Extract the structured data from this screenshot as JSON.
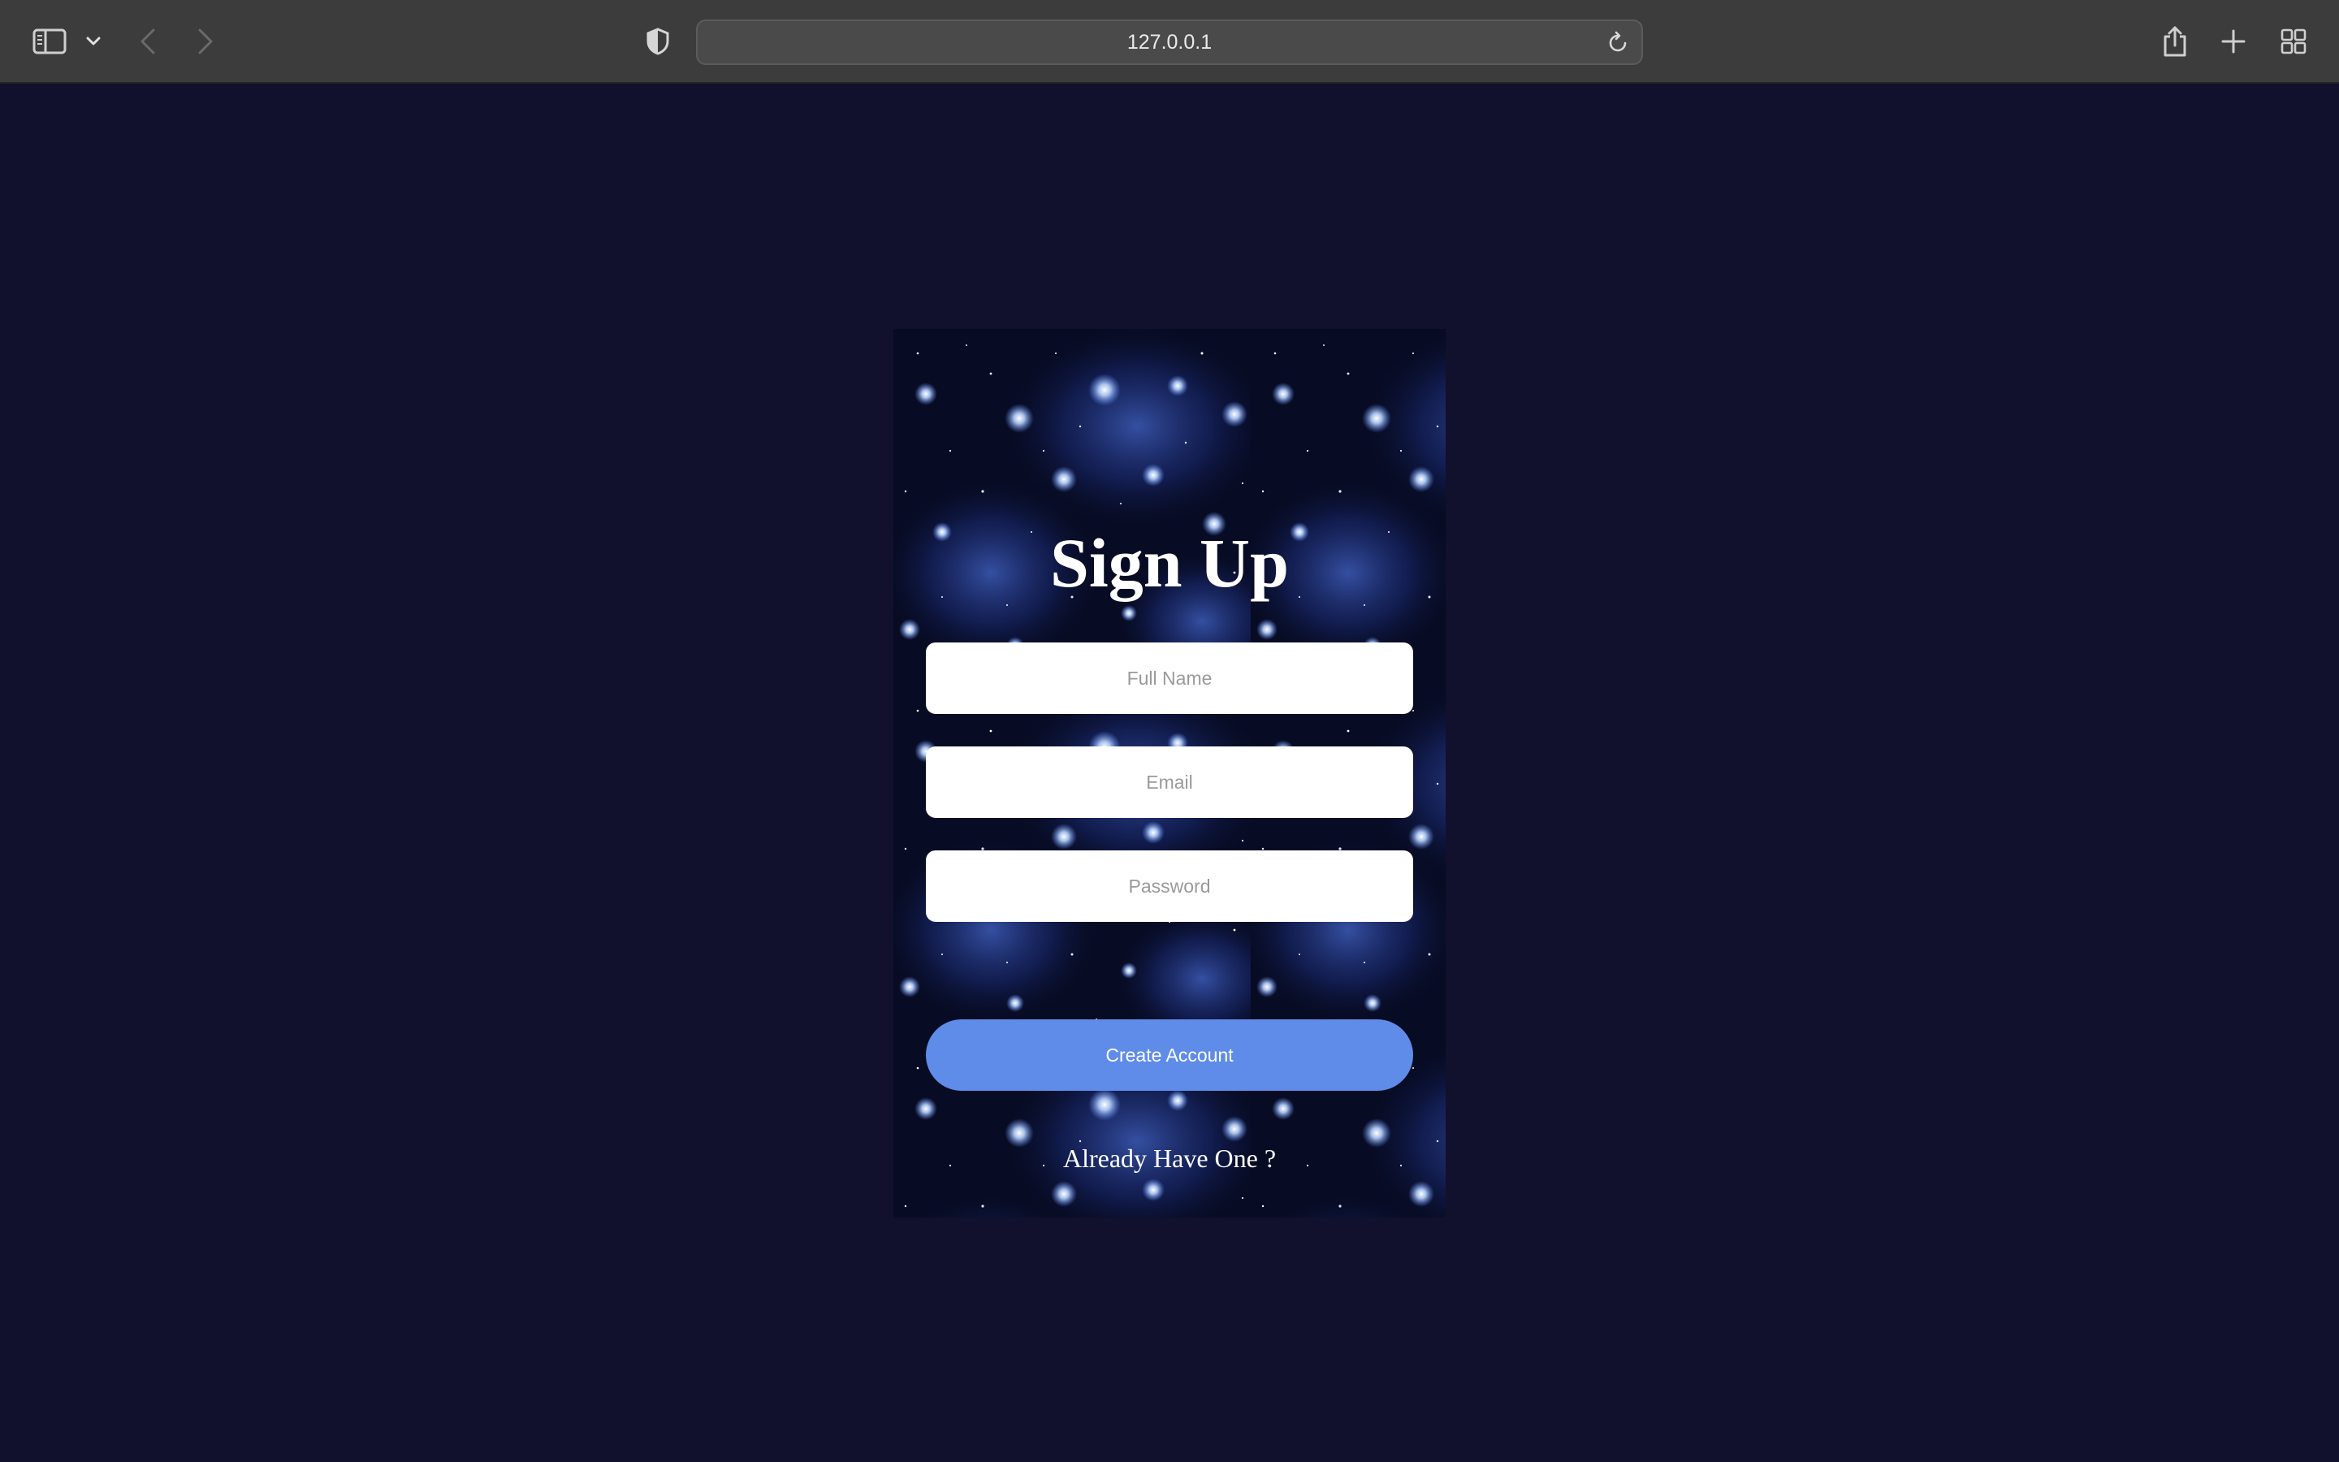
{
  "browser": {
    "address": "127.0.0.1",
    "icons": {
      "sidebar": "sidebar-icon",
      "sidebar_menu": "chevron-down-icon",
      "back": "back-arrow-icon",
      "forward": "forward-arrow-icon",
      "privacy": "shield-icon",
      "reload": "reload-icon",
      "share": "share-icon",
      "new_tab": "plus-icon",
      "tab_overview": "grid-icon"
    }
  },
  "signup": {
    "title": "Sign Up",
    "full_name_placeholder": "Full Name",
    "email_placeholder": "Email",
    "password_placeholder": "Password",
    "submit_label": "Create Account",
    "login_link": "Already Have One ?"
  },
  "colors": {
    "page_background": "#11102d",
    "button": "#5e8ce8",
    "toolbar": "#3c3c3c"
  }
}
